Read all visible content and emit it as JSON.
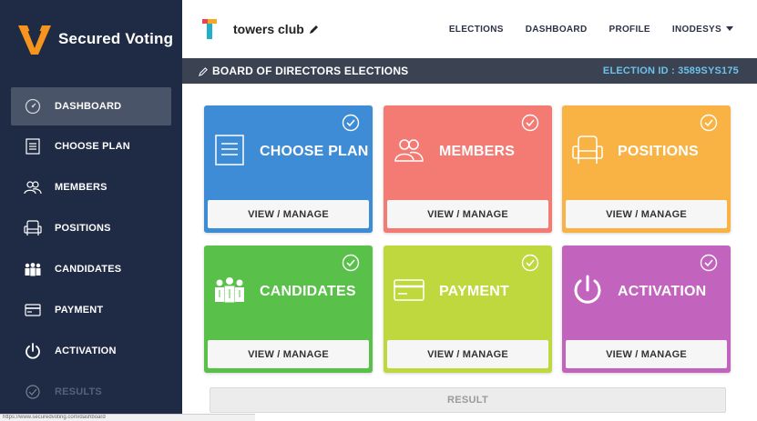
{
  "brand": {
    "name": "Secured Voting",
    "color": "#f7941d"
  },
  "sidebar": {
    "items": [
      {
        "label": "DASHBOARD",
        "icon": "dashboard-icon",
        "active": true
      },
      {
        "label": "CHOOSE PLAN",
        "icon": "list-icon"
      },
      {
        "label": "MEMBERS",
        "icon": "members-icon"
      },
      {
        "label": "POSITIONS",
        "icon": "chair-icon"
      },
      {
        "label": "CANDIDATES",
        "icon": "candidates-icon"
      },
      {
        "label": "PAYMENT",
        "icon": "card-icon"
      },
      {
        "label": "ACTIVATION",
        "icon": "power-icon"
      },
      {
        "label": "RESULTS",
        "icon": "results-icon",
        "dim": true
      }
    ]
  },
  "header": {
    "club": "towers club",
    "nav": {
      "elections": "ELECTIONS",
      "dashboard": "DASHBOARD",
      "profile": "PROFILE",
      "user": "INODESYS"
    }
  },
  "election": {
    "title": "BOARD OF DIRECTORS ELECTIONS",
    "id_text": "ELECTION ID : 3589SYS175"
  },
  "cards": [
    {
      "title": "CHOOSE PLAN",
      "button": "VIEW / MANAGE",
      "color": "#3e8cd6",
      "icon": "list-icon"
    },
    {
      "title": "MEMBERS",
      "button": "VIEW / MANAGE",
      "color": "#f47a74",
      "icon": "members-icon"
    },
    {
      "title": "POSITIONS",
      "button": "VIEW / MANAGE",
      "color": "#f9b244",
      "icon": "chair-icon"
    },
    {
      "title": "CANDIDATES",
      "button": "VIEW / MANAGE",
      "color": "#59c14a",
      "icon": "candidates-icon"
    },
    {
      "title": "PAYMENT",
      "button": "VIEW / MANAGE",
      "color": "#bfd83d",
      "icon": "card-icon"
    },
    {
      "title": "ACTIVATION",
      "button": "VIEW / MANAGE",
      "color": "#c264bd",
      "icon": "power-icon"
    }
  ],
  "result_button": "RESULT",
  "status_url": "https://www.securedvoting.com/dashboard"
}
